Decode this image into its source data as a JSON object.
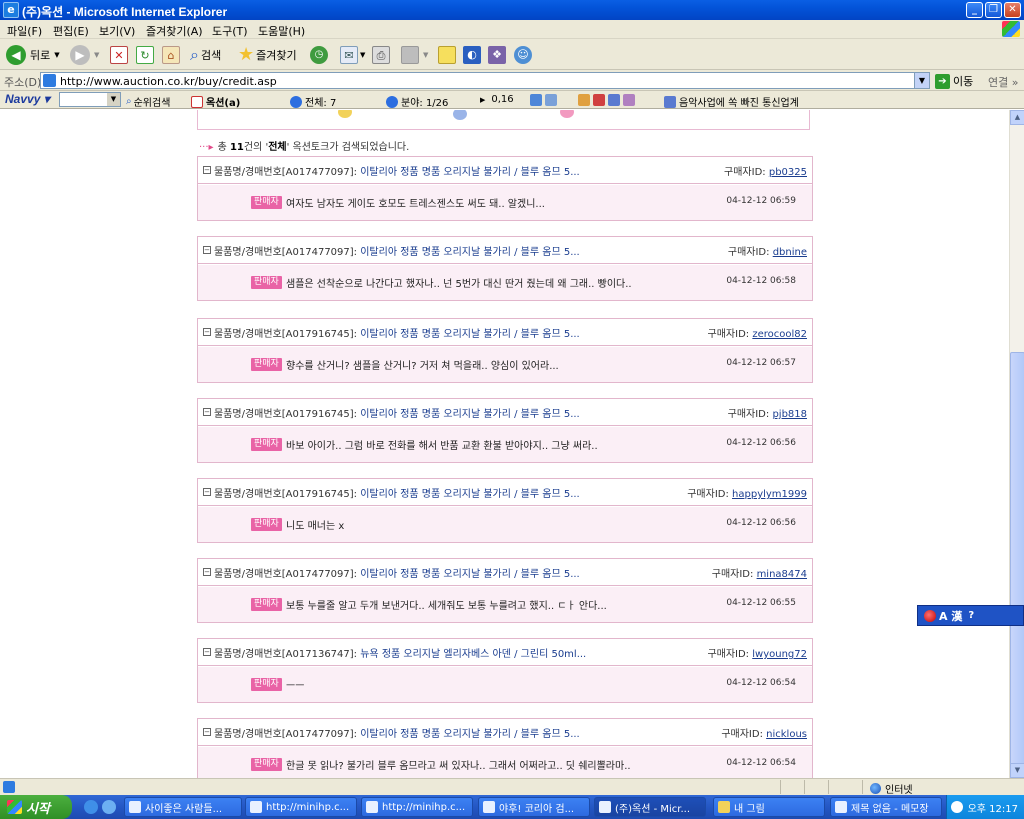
{
  "window": {
    "title": "(주)옥션 - Microsoft Internet Explorer"
  },
  "menu": [
    "파일(F)",
    "편집(E)",
    "보기(V)",
    "즐겨찾기(A)",
    "도구(T)",
    "도움말(H)"
  ],
  "toolbar": {
    "back": "뒤로",
    "search": "검색",
    "favorites": "즐겨찾기"
  },
  "address": {
    "label": "주소(D)",
    "url": "http://www.auction.co.kr/buy/credit.asp",
    "go": "이동",
    "links": "연결"
  },
  "navvy": {
    "brand": "Navvy",
    "rank_search": "순위검색",
    "auction": "옥션(a)",
    "total": "전체: 7",
    "section": "분야: 1/26",
    "score": "0,16",
    "news": "음악사업에 쏙 빠진 통신업계"
  },
  "summary": {
    "prefix": "총",
    "count": "11",
    "middle": "건의 '",
    "category": "전체",
    "suffix": "' 옥션토크가 검색되었습니다."
  },
  "entries": [
    {
      "prefix": "물품명/경매번호[A017477097]:",
      "product": "이탈리아 정품 명품 오리지날 불가리 / 블루 옴므 5...",
      "buyer_label": "구매자ID:",
      "buyer_id": "pb0325",
      "tag": "판매자",
      "message": "여자도 남자도 게이도 호모도 트레스젠스도 써도 돼.. 알겠니...",
      "date": "04-12-12 06:59"
    },
    {
      "prefix": "물품명/경매번호[A017477097]:",
      "product": "이탈리아 정품 명품 오리지날 불가리 / 블루 옴므 5...",
      "buyer_label": "구매자ID:",
      "buyer_id": "dbnine",
      "tag": "판매자",
      "message": "샘플은 선착순으로 나간다고 했자나.. 넌 5번가 대신 딴거 줬는데 왜 그래.. 빵이다..",
      "date": "04-12-12 06:58"
    },
    {
      "prefix": "물품명/경매번호[A017916745]:",
      "product": "이탈리아 정품 명품 오리지날 불가리 / 블루 옴므 5...",
      "buyer_label": "구매자ID:",
      "buyer_id": "zerocool82",
      "tag": "판매자",
      "message": "향수를 산거니? 샘플을 산거니? 거저 쳐 먹을래.. 양심이 있어라...",
      "date": "04-12-12 06:57"
    },
    {
      "prefix": "물품명/경매번호[A017916745]:",
      "product": "이탈리아 정품 명품 오리지날 불가리 / 블루 옴므 5...",
      "buyer_label": "구매자ID:",
      "buyer_id": "pjb818",
      "tag": "판매자",
      "message": "바보 아이가.. 그럼 바로 전화를 해서 반품 교환 환불 받아야지.. 그냥 써라..",
      "date": "04-12-12 06:56"
    },
    {
      "prefix": "물품명/경매번호[A017916745]:",
      "product": "이탈리아 정품 명품 오리지날 불가리 / 블루 옴므 5...",
      "buyer_label": "구매자ID:",
      "buyer_id": "happylym1999",
      "tag": "판매자",
      "message": "니도 매너는 x",
      "date": "04-12-12 06:56"
    },
    {
      "prefix": "물품명/경매번호[A017477097]:",
      "product": "이탈리아 정품 명품 오리지날 불가리 / 블루 옴므 5...",
      "buyer_label": "구매자ID:",
      "buyer_id": "mina8474",
      "tag": "판매자",
      "message": "보통 누를줄 알고 두개 보낸거다.. 세개줘도 보통 누를려고 했지.. ㄷㅏ 안다...",
      "date": "04-12-12 06:55"
    },
    {
      "prefix": "물품명/경매번호[A017136747]:",
      "product": "뉴욕 정품 오리지날 엘리자베스 아덴 / 그린티 50ml...",
      "buyer_label": "구매자ID:",
      "buyer_id": "lwyoung72",
      "tag": "판매자",
      "message": "ㅡㅡ",
      "date": "04-12-12 06:54"
    },
    {
      "prefix": "물품명/경매번호[A017477097]:",
      "product": "이탈리아 정품 명품 오리지날 불가리 / 블루 옴므 5...",
      "buyer_label": "구매자ID:",
      "buyer_id": "nicklous",
      "tag": "판매자",
      "message": "한글 못 읽나? 불가리 블루 옴므라고 써 있자나.. 그래서 어쩌라고.. 딧 쉐리뽈라마..",
      "date": "04-12-12 06:54"
    }
  ],
  "langbar": {
    "label": "A 漢"
  },
  "status": {
    "zone": "인터넷"
  },
  "taskbar": {
    "start": "시작",
    "tasks": [
      "사이좋은 사람들...",
      "http://minihp.c...",
      "http://minihp.c...",
      "야후! 코리아 검...",
      "(주)옥션 - Micr...",
      "내 그림",
      "제목 없음 - 메모장"
    ],
    "clock": "오후 12:17"
  }
}
